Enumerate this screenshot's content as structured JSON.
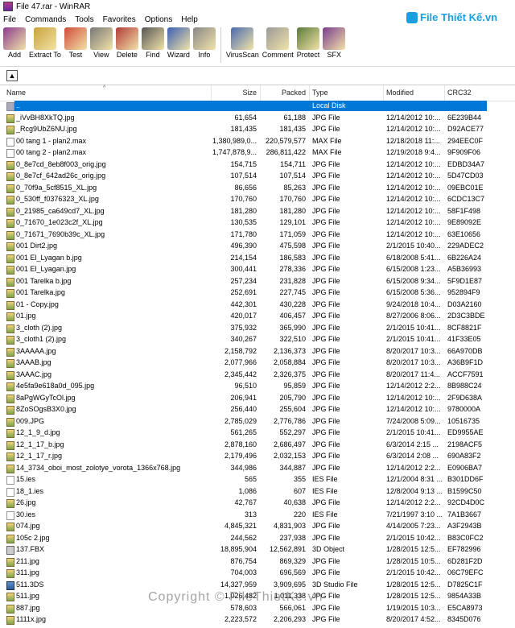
{
  "window": {
    "title": "File 47.rar - WinRAR"
  },
  "menu": [
    "File",
    "Commands",
    "Tools",
    "Favorites",
    "Options",
    "Help"
  ],
  "brand": "File Thiết Kế.vn",
  "toolbar": [
    {
      "label": "Add",
      "icon": "add-icon",
      "color": "#8b3a8e"
    },
    {
      "label": "Extract To",
      "icon": "extract-icon",
      "color": "#c9a23a"
    },
    {
      "label": "Test",
      "icon": "test-icon",
      "color": "#d04a3a"
    },
    {
      "label": "View",
      "icon": "view-icon",
      "color": "#777777"
    },
    {
      "label": "Delete",
      "icon": "delete-icon",
      "color": "#b23a3a"
    },
    {
      "label": "Find",
      "icon": "find-icon",
      "color": "#555555"
    },
    {
      "label": "Wizard",
      "icon": "wizard-icon",
      "color": "#3a5fb2"
    },
    {
      "label": "Info",
      "icon": "info-icon",
      "color": "#888888"
    },
    {
      "label": "VirusScan",
      "icon": "virusscan-icon",
      "color": "#4a6ab0"
    },
    {
      "label": "Comment",
      "icon": "comment-icon",
      "color": "#999999"
    },
    {
      "label": "Protect",
      "icon": "protect-icon",
      "color": "#5a7a3a"
    },
    {
      "label": "SFX",
      "icon": "sfx-icon",
      "color": "#7a3a8e"
    }
  ],
  "columns": {
    "name": "Name",
    "size": "Size",
    "packed": "Packed",
    "type": "Type",
    "modified": "Modified",
    "crc": "CRC32"
  },
  "rows": [
    {
      "name": "..",
      "size": "",
      "packed": "",
      "type": "Local Disk",
      "modified": "",
      "crc": "",
      "icon": "up"
    },
    {
      "name": "_iVvBH8XkTQ.jpg",
      "size": "61,654",
      "packed": "61,188",
      "type": "JPG File",
      "modified": "12/14/2012 10:...",
      "crc": "6E239B44",
      "icon": "jpg"
    },
    {
      "name": "_Rcg9UbZ6NU.jpg",
      "size": "181,435",
      "packed": "181,435",
      "type": "JPG File",
      "modified": "12/14/2012 10:...",
      "crc": "D92ACE77",
      "icon": "jpg"
    },
    {
      "name": "00 tang 1 - plan2.max",
      "size": "1,380,989,0...",
      "packed": "220,579,577",
      "type": "MAX File",
      "modified": "12/18/2018 11:...",
      "crc": "294EEC0F",
      "icon": "max"
    },
    {
      "name": "00 tang 2 - plan2.max",
      "size": "1,747,878,9...",
      "packed": "286,811,422",
      "type": "MAX File",
      "modified": "12/19/2018 9:4...",
      "crc": "9F909F06",
      "icon": "max"
    },
    {
      "name": "0_8e7cd_8eb8f003_orig.jpg",
      "size": "154,715",
      "packed": "154,711",
      "type": "JPG File",
      "modified": "12/14/2012 10:...",
      "crc": "EDBD34A7",
      "icon": "jpg"
    },
    {
      "name": "0_8e7cf_642ad26c_orig.jpg",
      "size": "107,514",
      "packed": "107,514",
      "type": "JPG File",
      "modified": "12/14/2012 10:...",
      "crc": "5D47CD03",
      "icon": "jpg"
    },
    {
      "name": "0_70f9a_5cf8515_XL.jpg",
      "size": "86,656",
      "packed": "85,263",
      "type": "JPG File",
      "modified": "12/14/2012 10:...",
      "crc": "09EBC01E",
      "icon": "jpg"
    },
    {
      "name": "0_530ff_f0376323_XL.jpg",
      "size": "170,760",
      "packed": "170,760",
      "type": "JPG File",
      "modified": "12/14/2012 10:...",
      "crc": "6CDC13C7",
      "icon": "jpg"
    },
    {
      "name": "0_21985_ca649cd7_XL.jpg",
      "size": "181,280",
      "packed": "181,280",
      "type": "JPG File",
      "modified": "12/14/2012 10:...",
      "crc": "58F1F498",
      "icon": "jpg"
    },
    {
      "name": "0_71670_1e023c2f_XL.jpg",
      "size": "130,535",
      "packed": "129,101",
      "type": "JPG File",
      "modified": "12/14/2012 10:...",
      "crc": "9E89092E",
      "icon": "jpg"
    },
    {
      "name": "0_71671_7690b39c_XL.jpg",
      "size": "171,780",
      "packed": "171,059",
      "type": "JPG File",
      "modified": "12/14/2012 10:...",
      "crc": "63E10656",
      "icon": "jpg"
    },
    {
      "name": "001 Dirt2.jpg",
      "size": "496,390",
      "packed": "475,598",
      "type": "JPG File",
      "modified": "2/1/2015 10:40...",
      "crc": "229ADEC2",
      "icon": "jpg"
    },
    {
      "name": "001 El_Lyagan b.jpg",
      "size": "214,154",
      "packed": "186,583",
      "type": "JPG File",
      "modified": "6/18/2008 5:41...",
      "crc": "6B226A24",
      "icon": "jpg"
    },
    {
      "name": "001 El_Lyagan.jpg",
      "size": "300,441",
      "packed": "278,336",
      "type": "JPG File",
      "modified": "6/15/2008 1:23...",
      "crc": "A5B36993",
      "icon": "jpg"
    },
    {
      "name": "001 Tarelka b.jpg",
      "size": "257,234",
      "packed": "231,828",
      "type": "JPG File",
      "modified": "6/15/2008 9:34...",
      "crc": "5F9D1E87",
      "icon": "jpg"
    },
    {
      "name": "001 Tarelka.jpg",
      "size": "252,691",
      "packed": "227,745",
      "type": "JPG File",
      "modified": "6/15/2008 5:36...",
      "crc": "952894F9",
      "icon": "jpg"
    },
    {
      "name": "01 - Copy.jpg",
      "size": "442,301",
      "packed": "430,228",
      "type": "JPG File",
      "modified": "9/24/2018 10:4...",
      "crc": "D03A2160",
      "icon": "jpg"
    },
    {
      "name": "01.jpg",
      "size": "420,017",
      "packed": "406,457",
      "type": "JPG File",
      "modified": "8/27/2006 8:06...",
      "crc": "2D3C3BDE",
      "icon": "jpg"
    },
    {
      "name": "3_cloth (2).jpg",
      "size": "375,932",
      "packed": "365,990",
      "type": "JPG File",
      "modified": "2/1/2015 10:41...",
      "crc": "8CF8821F",
      "icon": "jpg"
    },
    {
      "name": "3_cloth1 (2).jpg",
      "size": "340,267",
      "packed": "322,510",
      "type": "JPG File",
      "modified": "2/1/2015 10:41...",
      "crc": "41F33E05",
      "icon": "jpg"
    },
    {
      "name": "3AAAAA.jpg",
      "size": "2,158,792",
      "packed": "2,136,373",
      "type": "JPG File",
      "modified": "8/20/2017 10:3...",
      "crc": "66A970DB",
      "icon": "jpg"
    },
    {
      "name": "3AAAB.jpg",
      "size": "2,077,966",
      "packed": "2,058,884",
      "type": "JPG File",
      "modified": "8/20/2017 10:3...",
      "crc": "A36B9F1D",
      "icon": "jpg"
    },
    {
      "name": "3AAAC.jpg",
      "size": "2,345,442",
      "packed": "2,326,375",
      "type": "JPG File",
      "modified": "8/20/2017 11:4...",
      "crc": "ACCF7591",
      "icon": "jpg"
    },
    {
      "name": "4e5fa9e618a0d_095.jpg",
      "size": "96,510",
      "packed": "95,859",
      "type": "JPG File",
      "modified": "12/14/2012 2:2...",
      "crc": "8B988C24",
      "icon": "jpg"
    },
    {
      "name": "8aPgWGyTcOl.jpg",
      "size": "206,941",
      "packed": "205,790",
      "type": "JPG File",
      "modified": "12/14/2012 10:...",
      "crc": "2F9D638A",
      "icon": "jpg"
    },
    {
      "name": "8ZoSOgsB3X0.jpg",
      "size": "256,440",
      "packed": "255,604",
      "type": "JPG File",
      "modified": "12/14/2012 10:...",
      "crc": "9780000A",
      "icon": "jpg"
    },
    {
      "name": "009.JPG",
      "size": "2,785,029",
      "packed": "2,776,786",
      "type": "JPG File",
      "modified": "7/24/2008 5:09...",
      "crc": "10516735",
      "icon": "jpg"
    },
    {
      "name": "12_1_9_d.jpg",
      "size": "561,265",
      "packed": "552,297",
      "type": "JPG File",
      "modified": "2/1/2015 10:41...",
      "crc": "ED9955AE",
      "icon": "jpg"
    },
    {
      "name": "12_1_17_b.jpg",
      "size": "2,878,160",
      "packed": "2,686,497",
      "type": "JPG File",
      "modified": "6/3/2014 2:15 ...",
      "crc": "2198ACF5",
      "icon": "jpg"
    },
    {
      "name": "12_1_17_r.jpg",
      "size": "2,179,496",
      "packed": "2,032,153",
      "type": "JPG File",
      "modified": "6/3/2014 2:08 ...",
      "crc": "690A83F2",
      "icon": "jpg"
    },
    {
      "name": "14_3734_oboi_most_zolotye_vorota_1366x768.jpg",
      "size": "344,986",
      "packed": "344,887",
      "type": "JPG File",
      "modified": "12/14/2012 2:2...",
      "crc": "E0906BA7",
      "icon": "jpg"
    },
    {
      "name": "15.ies",
      "size": "565",
      "packed": "355",
      "type": "IES File",
      "modified": "12/1/2004 8:31 ...",
      "crc": "B301DD6F",
      "icon": "ies"
    },
    {
      "name": "18_1.ies",
      "size": "1,086",
      "packed": "607",
      "type": "IES File",
      "modified": "12/8/2004 9:13 ...",
      "crc": "B1599C50",
      "icon": "ies"
    },
    {
      "name": "26.jpg",
      "size": "42,767",
      "packed": "40,638",
      "type": "JPG File",
      "modified": "12/14/2012 2:2...",
      "crc": "92CD4D0C",
      "icon": "jpg"
    },
    {
      "name": "30.ies",
      "size": "313",
      "packed": "220",
      "type": "IES File",
      "modified": "7/21/1997 3:10 ...",
      "crc": "7A1B3667",
      "icon": "ies"
    },
    {
      "name": "074.jpg",
      "size": "4,845,321",
      "packed": "4,831,903",
      "type": "JPG File",
      "modified": "4/14/2005 7:23...",
      "crc": "A3F2943B",
      "icon": "jpg"
    },
    {
      "name": "105c 2.jpg",
      "size": "244,562",
      "packed": "237,938",
      "type": "JPG File",
      "modified": "2/1/2015 10:42...",
      "crc": "B83C0FC2",
      "icon": "jpg"
    },
    {
      "name": "137.FBX",
      "size": "18,895,904",
      "packed": "12,562,891",
      "type": "3D Object",
      "modified": "1/28/2015 12:5...",
      "crc": "EF782996",
      "icon": "fbx"
    },
    {
      "name": "211.jpg",
      "size": "876,754",
      "packed": "869,329",
      "type": "JPG File",
      "modified": "1/28/2015 10:5...",
      "crc": "6D281F2D",
      "icon": "jpg"
    },
    {
      "name": "311.jpg",
      "size": "704,003",
      "packed": "696,569",
      "type": "JPG File",
      "modified": "2/1/2015 10:42...",
      "crc": "06C79EFC",
      "icon": "jpg"
    },
    {
      "name": "511.3DS",
      "size": "14,327,959",
      "packed": "3,909,695",
      "type": "3D Studio File",
      "modified": "1/28/2015 12:5...",
      "crc": "D7825C1F",
      "icon": "ds"
    },
    {
      "name": "511.jpg",
      "size": "1,026,482",
      "packed": "1,011,338",
      "type": "JPG File",
      "modified": "1/28/2015 12:5...",
      "crc": "9854A33B",
      "icon": "jpg"
    },
    {
      "name": "887.jpg",
      "size": "578,603",
      "packed": "566,061",
      "type": "JPG File",
      "modified": "1/19/2015 10:3...",
      "crc": "E5CA8973",
      "icon": "jpg"
    },
    {
      "name": "1111x.jpg",
      "size": "2,223,572",
      "packed": "2,206,293",
      "type": "JPG File",
      "modified": "8/20/2017 4:52...",
      "crc": "8345D076",
      "icon": "jpg"
    }
  ],
  "watermark": "Copyright © FileThietKe.vn"
}
